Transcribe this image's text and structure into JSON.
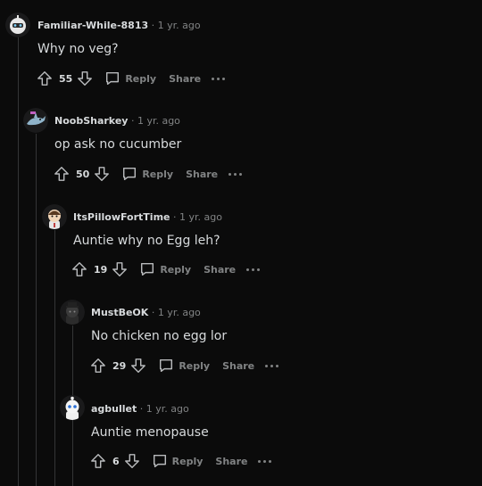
{
  "separator": "·",
  "actions": {
    "reply_label": "Reply",
    "share_label": "Share"
  },
  "comments": [
    {
      "username": "Familiar-While-8813",
      "age": "1 yr. ago",
      "text": "Why no veg?",
      "score": "55",
      "avatar": "white-robot-avatar-icon"
    },
    {
      "username": "NoobSharkey",
      "age": "1 yr. ago",
      "text": "op ask no cucumber",
      "score": "50",
      "avatar": "shark-avatar-icon"
    },
    {
      "username": "ItsPillowFortTime",
      "age": "1 yr. ago",
      "text": "Auntie why no Egg leh?",
      "score": "19",
      "avatar": "snoo-avatar-icon"
    },
    {
      "username": "MustBeOK",
      "age": "1 yr. ago",
      "text": "No chicken no egg lor",
      "score": "29",
      "avatar": "dark-snoo-avatar-icon"
    },
    {
      "username": "agbullet",
      "age": "1 yr. ago",
      "text": "Auntie menopause",
      "score": "6",
      "avatar": "white-snoo-avatar-icon"
    }
  ]
}
